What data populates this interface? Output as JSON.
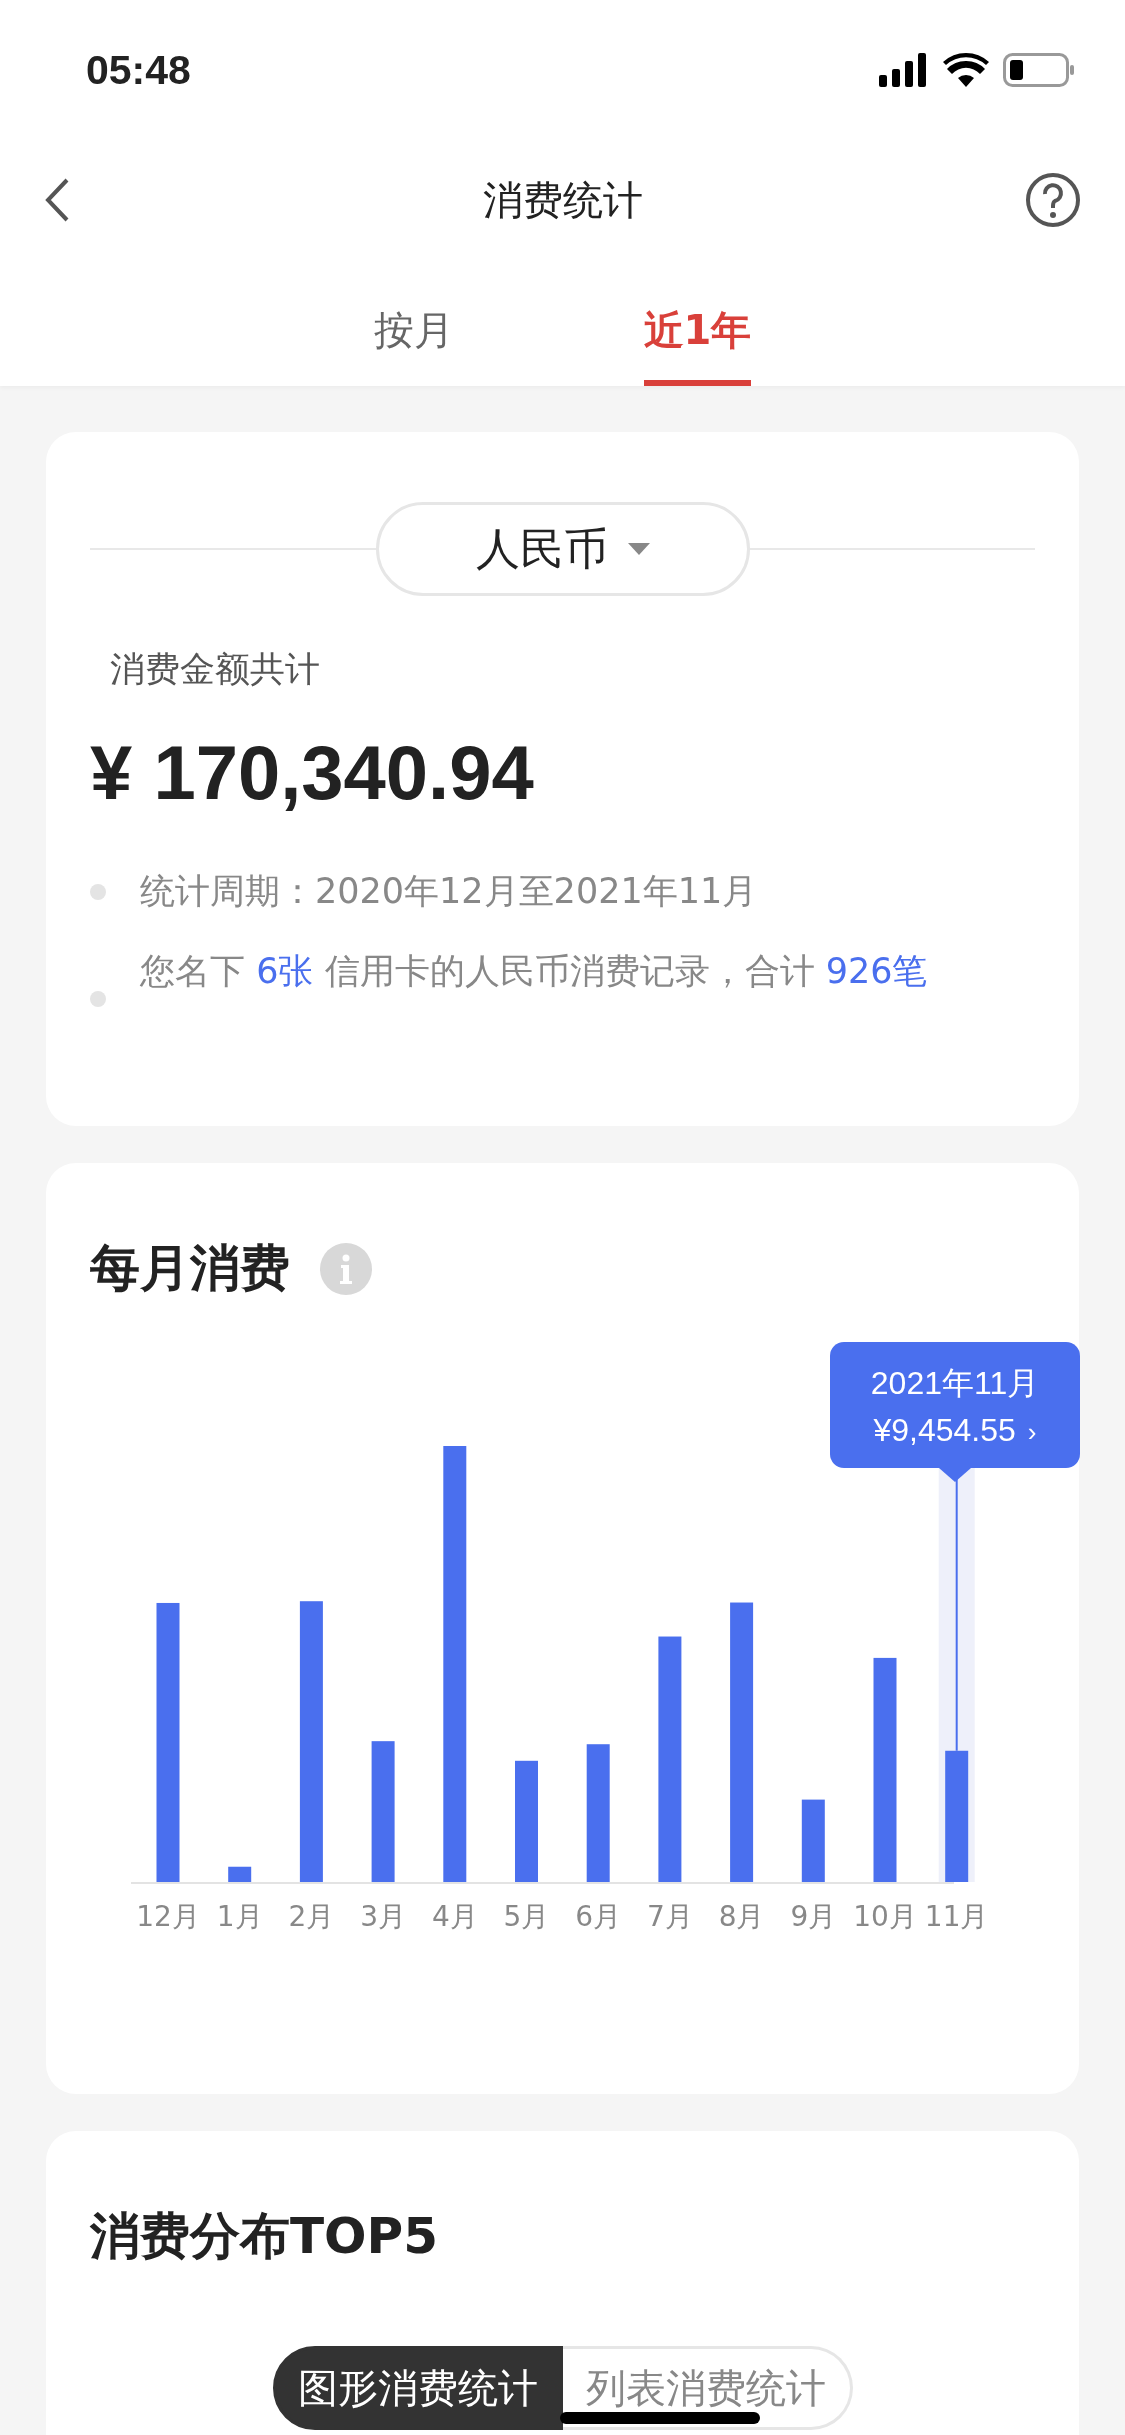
{
  "status_bar": {
    "time": "05:48"
  },
  "nav": {
    "title": "消费统计"
  },
  "tabs": [
    {
      "label": "按月",
      "selected": false
    },
    {
      "label": "近1年",
      "selected": true
    }
  ],
  "summary": {
    "currency": "人民币",
    "label": "消费金额共计",
    "amount": "¥ 170,340.94",
    "notes": [
      "统计周期：2020年12月至2021年11月",
      "您名下 **6张** 信用卡的人民币消费记录，合计 **926笔**"
    ]
  },
  "monthly": {
    "title": "每月消费",
    "tooltip": {
      "date": "2021年11月",
      "amount": "¥9,454.55",
      "arrow": "›"
    },
    "months": [
      "12月",
      "1月",
      "2月",
      "3月",
      "4月",
      "5月",
      "6月",
      "7月",
      "8月",
      "9月",
      "10月",
      "11月"
    ]
  },
  "distribution": {
    "title": "消费分布TOP5",
    "toggle": [
      {
        "label": "图形消费统计",
        "selected": true
      },
      {
        "label": "列表消费统计",
        "selected": false
      }
    ]
  }
}
